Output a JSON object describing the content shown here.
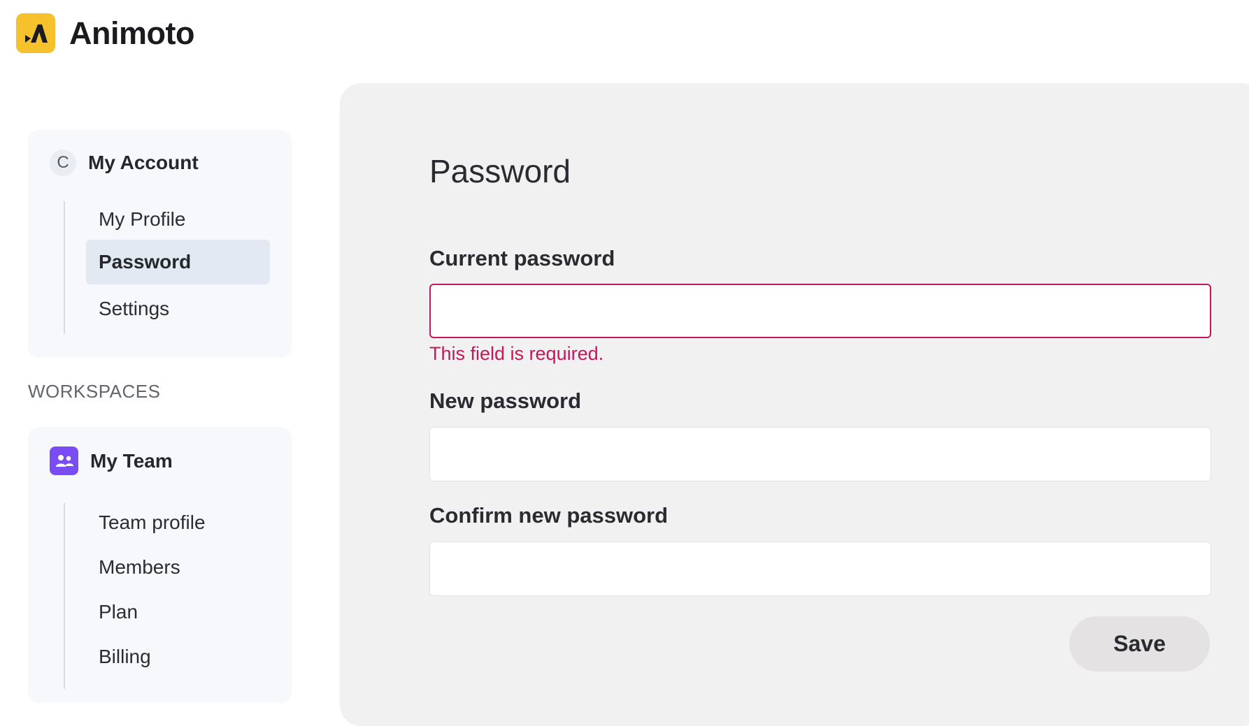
{
  "brand": {
    "name": "Animoto",
    "logo_icon": "animoto-logo-icon",
    "logo_color": "#f5c22e"
  },
  "sidebar": {
    "account": {
      "avatar_letter": "C",
      "label": "My Account",
      "items": [
        {
          "label": "My Profile",
          "active": false
        },
        {
          "label": "Password",
          "active": true
        },
        {
          "label": "Settings",
          "active": false
        }
      ]
    },
    "workspaces_heading": "WORKSPACES",
    "team": {
      "icon": "team-icon",
      "badge_color": "#7a4cf3",
      "label": "My Team",
      "items": [
        {
          "label": "Team profile"
        },
        {
          "label": "Members"
        },
        {
          "label": "Plan"
        },
        {
          "label": "Billing"
        }
      ]
    }
  },
  "main": {
    "title": "Password",
    "fields": {
      "current": {
        "label": "Current password",
        "value": "",
        "error": "This field is required."
      },
      "new": {
        "label": "New password",
        "value": ""
      },
      "confirm": {
        "label": "Confirm new password",
        "value": ""
      }
    },
    "save_label": "Save"
  },
  "colors": {
    "error": "#c2185b",
    "panel_bg": "#f2f1f1",
    "active_nav_bg": "#e3e9f3"
  }
}
